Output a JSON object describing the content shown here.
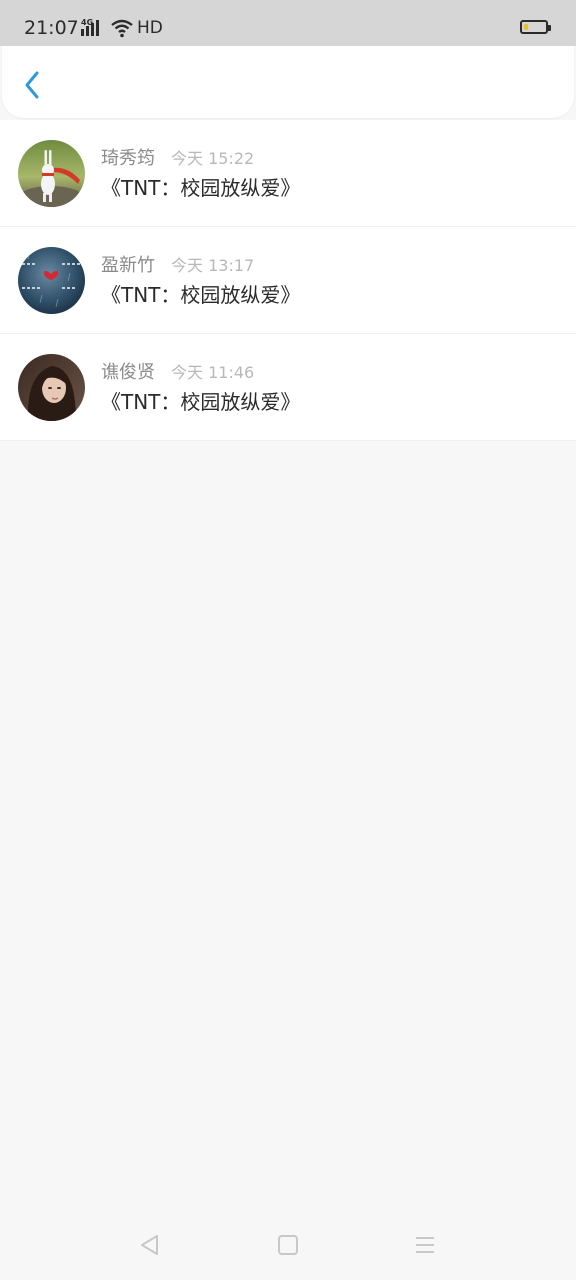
{
  "status_bar": {
    "time": "21:07",
    "network": "4G",
    "hd": "HD",
    "battery_level": 0.18,
    "battery_color": "#e2c42a"
  },
  "nav_bar": {
    "back_icon": "chevron-left-icon",
    "accent_color": "#2d9ad7"
  },
  "items": [
    {
      "name": "琦秀筠",
      "time": "今天 15:22",
      "message": "《TNT：校园放纵爱》",
      "avatar": "rabbit-avatar"
    },
    {
      "name": "盈新竹",
      "time": "今天 13:17",
      "message": "《TNT：校园放纵爱》",
      "avatar": "rain-avatar"
    },
    {
      "name": "谯俊贤",
      "time": "今天 11:46",
      "message": "《TNT：校园放纵爱》",
      "avatar": "girl-avatar"
    }
  ],
  "system_nav": {
    "back_icon": "triangle-back-icon",
    "home_icon": "square-home-icon",
    "menu_icon": "menu-lines-icon"
  }
}
